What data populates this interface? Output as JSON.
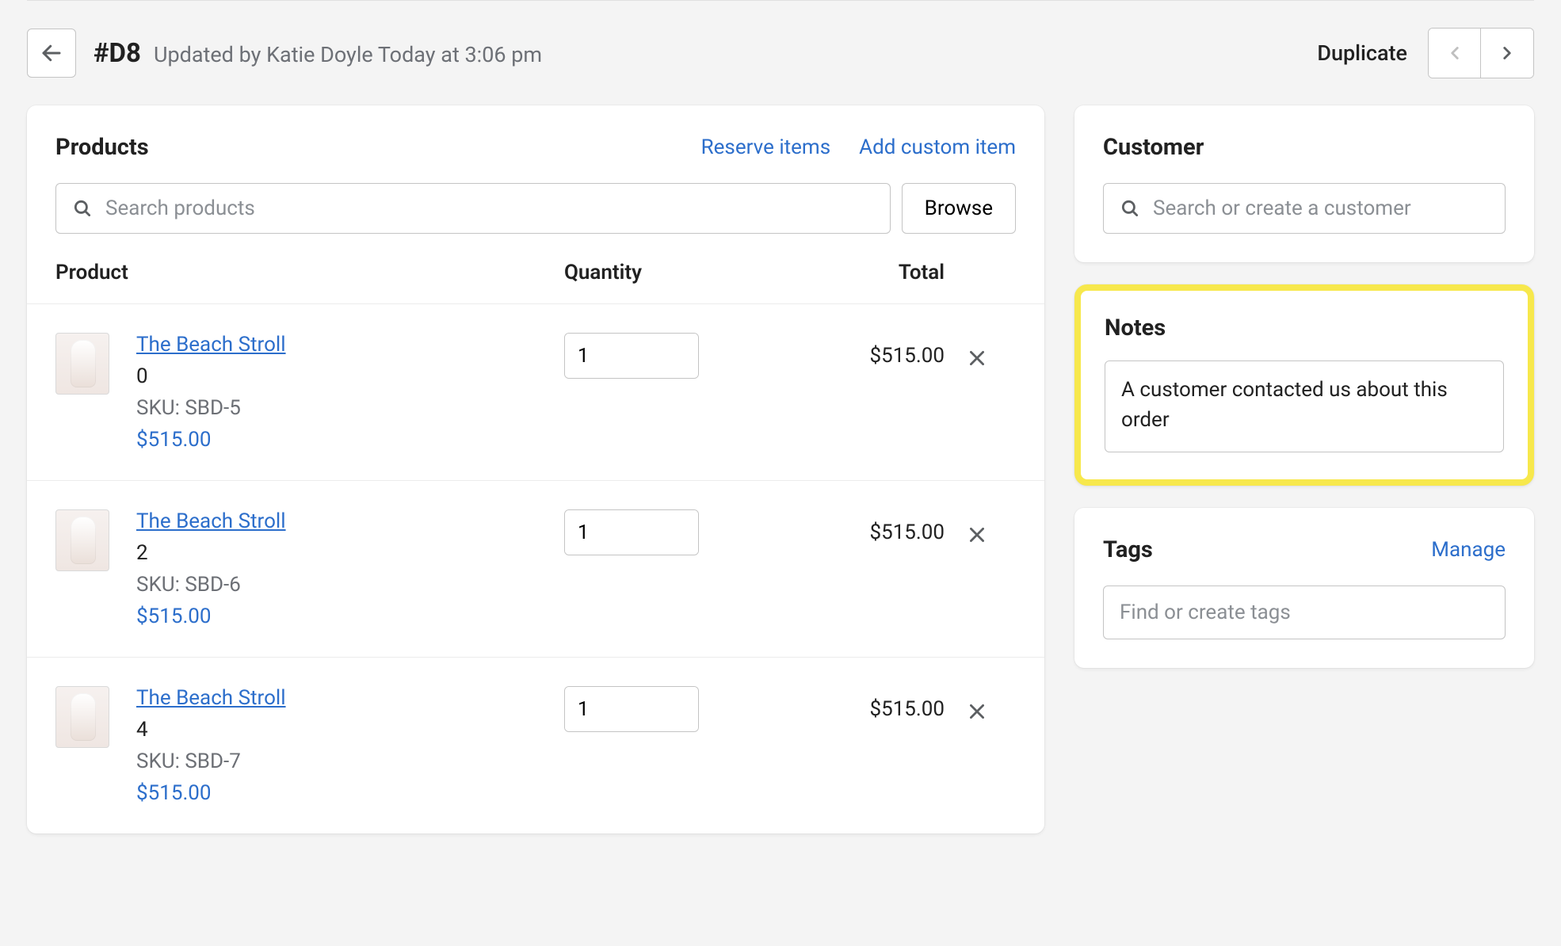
{
  "header": {
    "title": "#D8",
    "meta": "Updated by Katie Doyle Today at 3:06 pm",
    "duplicate_label": "Duplicate"
  },
  "products": {
    "title": "Products",
    "reserve_label": "Reserve items",
    "add_custom_label": "Add custom item",
    "search_placeholder": "Search products",
    "browse_label": "Browse",
    "columns": {
      "product": "Product",
      "quantity": "Quantity",
      "total": "Total"
    },
    "items": [
      {
        "name": "The Beach Stroll",
        "variant": "0",
        "sku": "SKU: SBD-5",
        "price": "$515.00",
        "quantity": "1",
        "total": "$515.00"
      },
      {
        "name": "The Beach Stroll",
        "variant": "2",
        "sku": "SKU: SBD-6",
        "price": "$515.00",
        "quantity": "1",
        "total": "$515.00"
      },
      {
        "name": "The Beach Stroll",
        "variant": "4",
        "sku": "SKU: SBD-7",
        "price": "$515.00",
        "quantity": "1",
        "total": "$515.00"
      }
    ]
  },
  "customer": {
    "title": "Customer",
    "search_placeholder": "Search or create a customer"
  },
  "notes": {
    "title": "Notes",
    "value": "A customer contacted us about this order"
  },
  "tags": {
    "title": "Tags",
    "manage_label": "Manage",
    "placeholder": "Find or create tags"
  }
}
